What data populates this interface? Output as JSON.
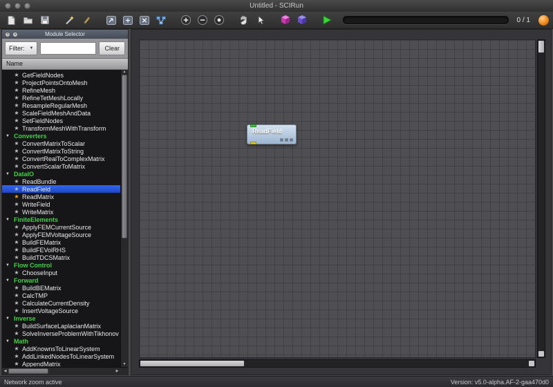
{
  "window": {
    "title": "Untitled - SCIRun"
  },
  "toolbar": {
    "progress_label": "0 / 1",
    "icon_names": [
      "new-network",
      "open-network",
      "save-network",
      "magic-wand",
      "pencil",
      "dock-arrow",
      "dock-plus",
      "clear-network",
      "network-graph",
      "zoom-in",
      "zoom-out",
      "zoom-reset",
      "pan-hand",
      "select-cursor",
      "pink-cube",
      "purple-cube",
      "execute-play",
      "execution-ball"
    ]
  },
  "module_selector": {
    "title": "Module Selector",
    "filter_label": "Filter:",
    "filter_value": "",
    "clear_label": "Clear",
    "name_header": "Name",
    "tree": [
      {
        "kind": "module",
        "label": "GetFieldNodes"
      },
      {
        "kind": "module",
        "label": "ProjectPointsOntoMesh"
      },
      {
        "kind": "module",
        "label": "RefineMesh"
      },
      {
        "kind": "module",
        "label": "RefineTetMeshLocally"
      },
      {
        "kind": "module",
        "label": "ResampleRegularMesh"
      },
      {
        "kind": "module",
        "label": "ScaleFieldMeshAndData"
      },
      {
        "kind": "module",
        "label": "SetFieldNodes"
      },
      {
        "kind": "module",
        "label": "TransformMeshWithTransform"
      },
      {
        "kind": "category",
        "label": "Converters"
      },
      {
        "kind": "module",
        "label": "ConvertMatrixToScalar"
      },
      {
        "kind": "module",
        "label": "ConvertMatrixToString"
      },
      {
        "kind": "module",
        "label": "ConvertRealToComplexMatrix"
      },
      {
        "kind": "module",
        "label": "ConvertScalarToMatrix"
      },
      {
        "kind": "category",
        "label": "DataIO"
      },
      {
        "kind": "module",
        "label": "ReadBundle"
      },
      {
        "kind": "module",
        "label": "ReadField",
        "selected": true
      },
      {
        "kind": "module",
        "label": "ReadMatrix",
        "favorite": true
      },
      {
        "kind": "module",
        "label": "WriteField"
      },
      {
        "kind": "module",
        "label": "WriteMatrix"
      },
      {
        "kind": "category",
        "label": "FiniteElements"
      },
      {
        "kind": "module",
        "label": "ApplyFEMCurrentSource"
      },
      {
        "kind": "module",
        "label": "ApplyFEMVoltageSource"
      },
      {
        "kind": "module",
        "label": "BuildFEMatrix"
      },
      {
        "kind": "module",
        "label": "BuildFEVolRHS"
      },
      {
        "kind": "module",
        "label": "BuildTDCSMatrix"
      },
      {
        "kind": "category",
        "label": "Flow Control"
      },
      {
        "kind": "module",
        "label": "ChooseInput"
      },
      {
        "kind": "category",
        "label": "Forward"
      },
      {
        "kind": "module",
        "label": "BuildBEMatrix"
      },
      {
        "kind": "module",
        "label": "CalcTMP"
      },
      {
        "kind": "module",
        "label": "CalculateCurrentDensity"
      },
      {
        "kind": "module",
        "label": "InsertVoltageSource"
      },
      {
        "kind": "category",
        "label": "Inverse"
      },
      {
        "kind": "module",
        "label": "BuildSurfaceLaplacianMatrix"
      },
      {
        "kind": "module",
        "label": "SolveInverseProblemWithTikhonov"
      },
      {
        "kind": "category",
        "label": "Math"
      },
      {
        "kind": "module",
        "label": "AddKnownsToLinearSystem"
      },
      {
        "kind": "module",
        "label": "AddLinkedNodesToLinearSystem"
      },
      {
        "kind": "module",
        "label": "AppendMatrix"
      }
    ]
  },
  "canvas": {
    "modules": [
      {
        "title": "ReadField"
      }
    ]
  },
  "statusbar": {
    "left": "Network zoom active",
    "right": "Version: v5.0-alpha.AF-2-gaa470d0"
  },
  "colors": {
    "category_text": "#3fd23f",
    "selection_blue": "#2256d8",
    "favorite_star": "#f5a623",
    "execute_green": "#39d839",
    "pink_cube": "#f27fe3",
    "purple_cube": "#6a4fd0",
    "execution_ball": "#f08a1d",
    "node_blue": "#9cb5d0"
  }
}
